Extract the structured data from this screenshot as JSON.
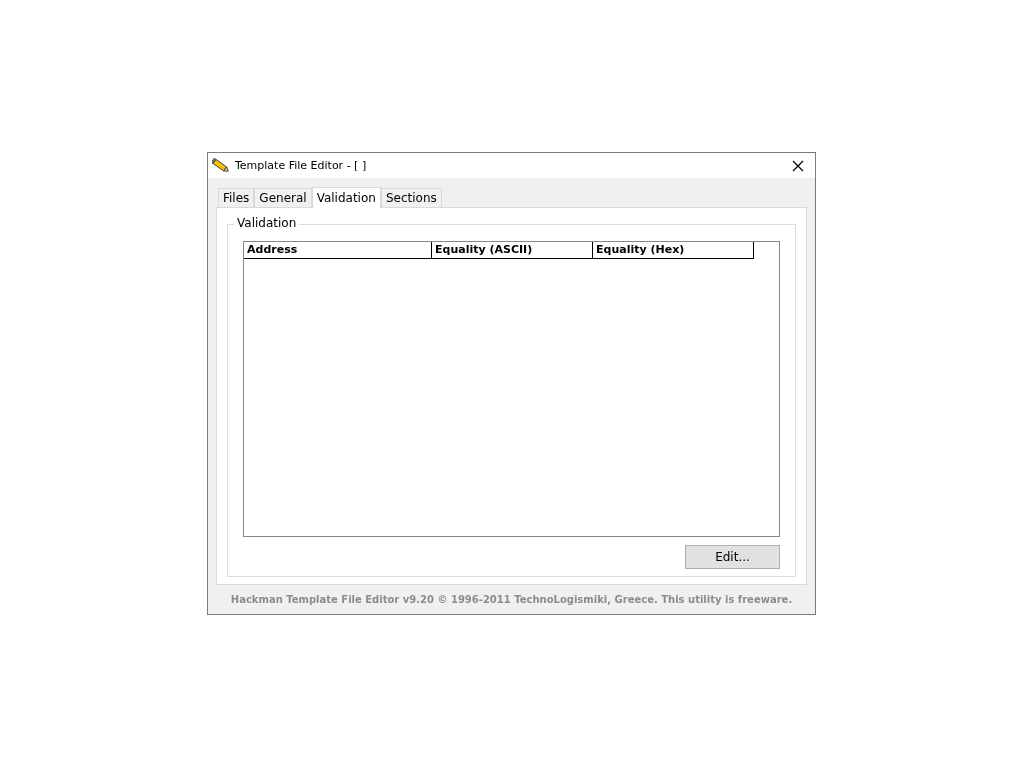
{
  "window": {
    "title": "Template File Editor - [ ]"
  },
  "tabs": [
    {
      "label": "Files",
      "selected": false
    },
    {
      "label": "General",
      "selected": false
    },
    {
      "label": "Validation",
      "selected": true
    },
    {
      "label": "Sections",
      "selected": false
    }
  ],
  "group": {
    "title": "Validation"
  },
  "table": {
    "columns": [
      "Address",
      "Equality (ASCII)",
      "Equality (Hex)"
    ]
  },
  "buttons": [
    "Edit..."
  ],
  "status_text": "Hackman Template File Editor v9.20 © 1996-2011 TechnoLogismiki, Greece. This utility is freeware."
}
